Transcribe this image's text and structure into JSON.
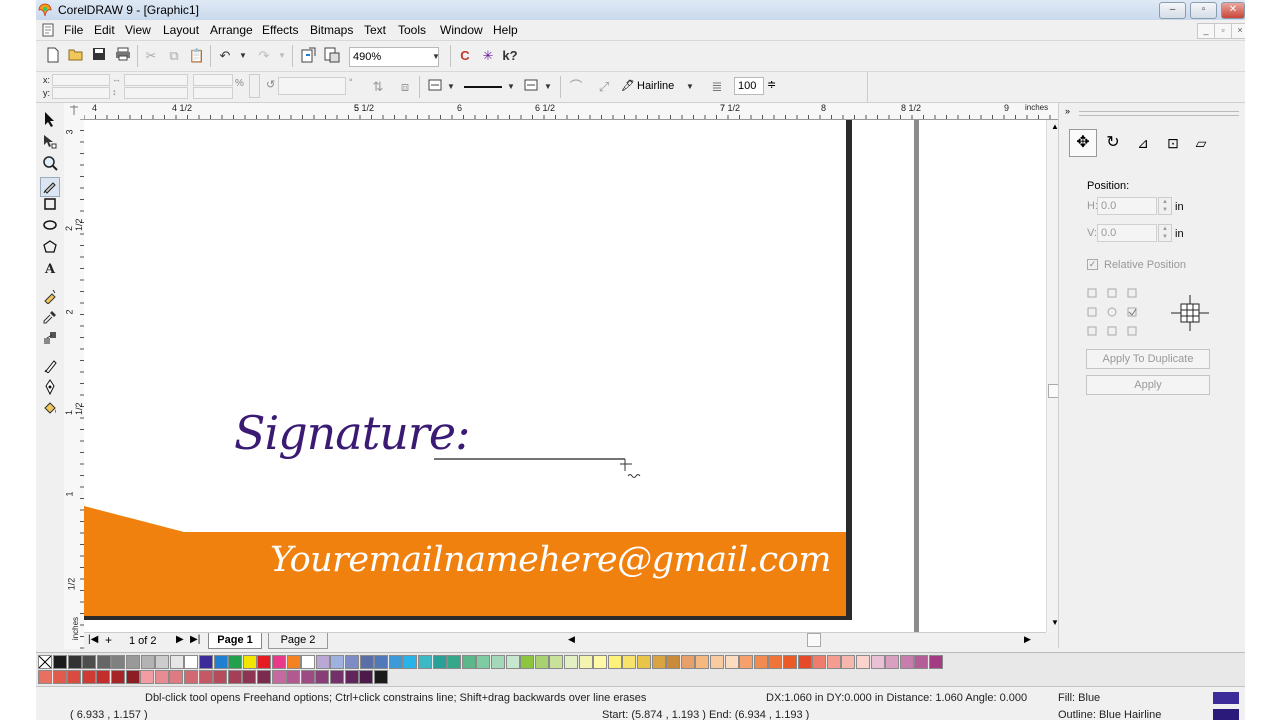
{
  "window": {
    "title": "CorelDRAW 9 - [Graphic1]",
    "buttons": [
      "–",
      "▫",
      "✕"
    ]
  },
  "menubar": {
    "items": [
      "File",
      "Edit",
      "View",
      "Layout",
      "Arrange",
      "Effects",
      "Bitmaps",
      "Text",
      "Tools",
      "Window",
      "Help"
    ]
  },
  "toolbar": {
    "zoom": "490%"
  },
  "propertybar": {
    "x_label": "x:",
    "y_label": "y:",
    "outline_width": "Hairline",
    "scale": "100"
  },
  "ruler": {
    "unit": "inches",
    "top_labels": [
      "4",
      "4 1/2",
      "5",
      "5 1/2",
      "6",
      "6 1/2",
      "7",
      "7 1/2",
      "8",
      "8 1/2",
      "9"
    ],
    "left_labels": [
      "3",
      "2 1/2",
      "2",
      "1 1/2",
      "1",
      "1/2"
    ]
  },
  "document": {
    "signature_label": "Signature:",
    "email": "Youremailnamehere@gmail.com",
    "accent_color": "#f0810f",
    "text_color": "#3a1a73"
  },
  "pages": {
    "counter": "1 of 2",
    "tabs": [
      "Page 1",
      "Page 2"
    ]
  },
  "docker": {
    "position_label": "Position:",
    "h_label": "H:",
    "v_label": "V:",
    "h_value": "0.0",
    "v_value": "0.0",
    "unit": "in",
    "relative_position": "Relative Position",
    "apply_duplicate": "Apply To Duplicate",
    "apply": "Apply"
  },
  "status": {
    "hint": "Dbl-click tool opens Freehand options; Ctrl+click constrains line; Shift+drag backwards over line erases",
    "coords": "( 6.933 , 1.157 )",
    "measure": "DX:1.060 in DY:0.000 in Distance: 1.060 Angle: 0.000",
    "startend": "Start: (5.874 , 1.193 )  End: (6.934 , 1.193 )",
    "fill": "Fill: Blue",
    "outline": "Outline: Blue  Hairline",
    "fill_color": "#3b2c9a",
    "outline_color": "#2b1a7a"
  },
  "palette": {
    "row1": [
      "#1b1b1b",
      "#333333",
      "#4d4d4d",
      "#666666",
      "#808080",
      "#999999",
      "#b3b3b3",
      "#cccccc",
      "#e6e6e6",
      "#ffffff",
      "#3b2c9a",
      "#1f7fd0",
      "#22a04b",
      "#f2e600",
      "#e51d23",
      "#e8398b",
      "#f58220",
      "#ffffff",
      "#b9a7d6",
      "#9fb1e0",
      "#7d8cc4",
      "#5a6ea8",
      "#4f79b8",
      "#3d9ad6",
      "#2ab3e8",
      "#3eb8c4",
      "#2aa198",
      "#35a88a",
      "#5cb88a",
      "#7fcca3",
      "#a3d9b8",
      "#c6e8cf",
      "#8cc63f",
      "#a8d26f",
      "#c8e29b",
      "#e3f0c4",
      "#f2f4b0",
      "#fff9a8",
      "#fff27a",
      "#f7e26b",
      "#e8c547",
      "#d9a441",
      "#c98a3b",
      "#e8a06b",
      "#f5b87f",
      "#f8cba0",
      "#fbdcc0",
      "#f6a16b",
      "#f28b4f",
      "#ee7438",
      "#ea5b27",
      "#e54b2a",
      "#f07d6b",
      "#f39c8f",
      "#f6b8ae",
      "#f9d3cc",
      "#eac0d6",
      "#d99fc1",
      "#c77eac",
      "#b55d97",
      "#a33c82"
    ],
    "row2": [
      "#e87060",
      "#e25a4c",
      "#d94a3f",
      "#cf3b33",
      "#c12e2b",
      "#a62426",
      "#8c1d22",
      "#f29ca3",
      "#e88b92",
      "#dd7a82",
      "#d16973",
      "#c45864",
      "#b54b5d",
      "#a33f57",
      "#8f3352",
      "#7b2b4d",
      "#c56aa0",
      "#b15a92",
      "#9c4b84",
      "#883d76",
      "#743068",
      "#60255a",
      "#4c1b4c",
      "#1a1a1a"
    ]
  }
}
